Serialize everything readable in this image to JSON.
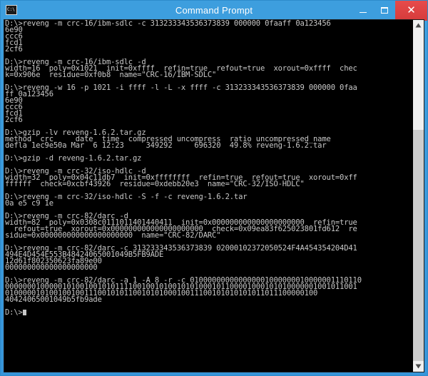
{
  "window": {
    "title": "Command Prompt",
    "icon_name": "command-prompt-icon",
    "icon_glyph": "C:\\",
    "accent_color": "#3a9bdc",
    "close_button_color": "#e04343",
    "buttons": {
      "minimize_label": "–",
      "maximize_label": "☐",
      "close_label": "✕"
    }
  },
  "console": {
    "background_color": "#000000",
    "text_color": "#c8c8c8",
    "prompt": "D:\\>",
    "lines": [
      "D:\\>reveng -m crc-16/ibm-sdlc -c 313233343536373839 000000 0faaff 0a123456",
      "6e90",
      "ccc6",
      "fcd1",
      "2cf6",
      "",
      "D:\\>reveng -m crc-16/ibm-sdlc -d",
      "width=16  poly=0x1021  init=0xffff  refin=true  refout=true  xorout=0xffff  chec",
      "k=0x906e  residue=0xf0b8  name=\"CRC-16/IBM-SDLC\"",
      "",
      "D:\\>reveng -w 16 -p 1021 -i ffff -l -L -x ffff -c 313233343536373839 000000 0faa",
      "ff 0a123456",
      "6e90",
      "ccc6",
      "fcd1",
      "2cf6",
      "",
      "D:\\>gzip -lv reveng-1.6.2.tar.gz",
      "method  crc     date  time  compressed uncompress  ratio uncompressed_name",
      "defla 1ec9e50a Mar  6 12:23     349292     696320  49.8% reveng-1.6.2.tar",
      "",
      "D:\\>gzip -d reveng-1.6.2.tar.gz",
      "",
      "D:\\>reveng -m crc-32/iso-hdlc -d",
      "width=32  poly=0x04c11db7  init=0xffffffff  refin=true  refout=true  xorout=0xff",
      "ffffff  check=0xcbf43926  residue=0xdebb20e3  name=\"CRC-32/ISO-HDLC\"",
      "",
      "D:\\>reveng -m crc-32/iso-hdlc -S -f -c reveng-1.6.2.tar",
      "0a e5 c9 1e",
      "",
      "D:\\>reveng -m crc-82/darc -d",
      "width=82  poly=0x0308c0111011401440411  init=0x000000000000000000000  refin=true",
      "  refout=true  xorout=0x000000000000000000000  check=0x09ea83f625023801fd612  re",
      "sidue=0x000000000000000000000  name=\"CRC-82/DARC\"",
      "",
      "D:\\>reveng -m crc-82/darc -c 313233343536373839 02000102372050524F4A454354204D41",
      "494E4D454E553B48424065001049B5FB9ADE",
      "12d61f802350623fa89e00",
      "000000000000000000000",
      "",
      "D:\\>reveng -m crc-82/darc -a 1 -A 8 -r -c 010000000000000001000000010000001110110",
      "00000001000001010010010101111001001010010101000101100001000101010000001001011001",
      "01000001010010010011100101011001010100010011100101010101011011100000100",
      "40424065001049b5fb9ade",
      "",
      "D:\\>"
    ]
  },
  "scrollbar": {
    "up_arrow_name": "scroll-up-arrow",
    "down_arrow_name": "scroll-down-arrow",
    "thumb_name": "scrollbar-thumb"
  }
}
